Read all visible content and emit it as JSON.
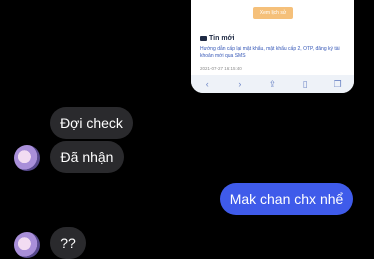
{
  "screenshot_preview": {
    "button_label": "Xem lịch sử",
    "news_heading": "Tin mới",
    "news_title": "Hướng dẫn cấp lại mật khẩu, mật khẩu cấp 2, OTP, đăng ký tài khoản mới qua SMS",
    "news_time": "2021-07-27 16:15:40",
    "toolbar_icons": [
      "back-icon",
      "forward-icon",
      "share-icon",
      "bookmarks-icon",
      "tabs-icon"
    ]
  },
  "messages": [
    {
      "sender": "other",
      "text": "Đợi check"
    },
    {
      "sender": "other",
      "text": "Đã nhận"
    },
    {
      "sender": "me",
      "text": "Mak chan chx nhể"
    },
    {
      "sender": "other",
      "text": "??"
    }
  ]
}
